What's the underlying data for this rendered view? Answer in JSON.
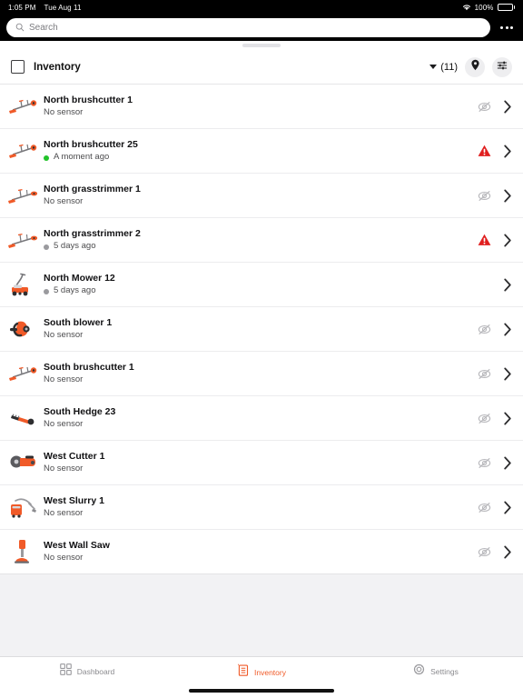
{
  "status_bar": {
    "time": "1:05 PM",
    "date": "Tue Aug 11",
    "battery_percent": "100%",
    "wifi_icon": "wifi-icon",
    "battery_icon": "battery-full-icon"
  },
  "search": {
    "placeholder": "Search",
    "value": "",
    "icon": "search-icon",
    "overflow_icon": "more-horizontal-icon"
  },
  "header": {
    "checkbox_checked": false,
    "title": "Inventory",
    "count": "(11)",
    "dropdown_icon": "chevron-down-icon",
    "map_icon": "map-pin-icon",
    "filter_icon": "filter-sliders-icon"
  },
  "colors": {
    "accent": "#f05a28",
    "alert": "#e01f1f",
    "online": "#22c32a",
    "offline": "#9a9a9e",
    "muted": "#b8b8bc",
    "background": "#f2f2f4"
  },
  "list": {
    "items": [
      {
        "name": "North brushcutter 1",
        "status_text": "No sensor",
        "dot": "none",
        "status_icon": "no-sensor-icon",
        "thumb": "brushcutter-icon"
      },
      {
        "name": "North brushcutter 25",
        "status_text": "A moment ago",
        "dot": "online",
        "status_icon": "warning-icon",
        "thumb": "brushcutter-icon"
      },
      {
        "name": "North grasstrimmer 1",
        "status_text": "No sensor",
        "dot": "none",
        "status_icon": "no-sensor-icon",
        "thumb": "grasstrimmer-icon"
      },
      {
        "name": "North grasstrimmer 2",
        "status_text": "5 days ago",
        "dot": "offline",
        "status_icon": "warning-icon",
        "thumb": "grasstrimmer-icon"
      },
      {
        "name": "North Mower 12",
        "status_text": "5 days ago",
        "dot": "offline",
        "status_icon": "none",
        "thumb": "lawn-mower-icon"
      },
      {
        "name": "South blower 1",
        "status_text": "No sensor",
        "dot": "none",
        "status_icon": "no-sensor-icon",
        "thumb": "backpack-blower-icon"
      },
      {
        "name": "South brushcutter 1",
        "status_text": "No sensor",
        "dot": "none",
        "status_icon": "no-sensor-icon",
        "thumb": "brushcutter-icon"
      },
      {
        "name": "South Hedge 23",
        "status_text": "No sensor",
        "dot": "none",
        "status_icon": "no-sensor-icon",
        "thumb": "hedge-trimmer-icon"
      },
      {
        "name": "West Cutter 1",
        "status_text": "No sensor",
        "dot": "none",
        "status_icon": "no-sensor-icon",
        "thumb": "power-cutter-icon"
      },
      {
        "name": "West Slurry 1",
        "status_text": "No sensor",
        "dot": "none",
        "status_icon": "no-sensor-icon",
        "thumb": "slurry-vacuum-icon"
      },
      {
        "name": "West Wall Saw",
        "status_text": "No sensor",
        "dot": "none",
        "status_icon": "no-sensor-icon",
        "thumb": "wall-saw-icon"
      }
    ]
  },
  "tabbar": {
    "items": [
      {
        "label": "Dashboard",
        "icon": "grid-dashboard-icon",
        "active": false
      },
      {
        "label": "Inventory",
        "icon": "clipboard-inventory-icon",
        "active": true
      },
      {
        "label": "Settings",
        "icon": "gear-icon",
        "active": false
      }
    ]
  }
}
